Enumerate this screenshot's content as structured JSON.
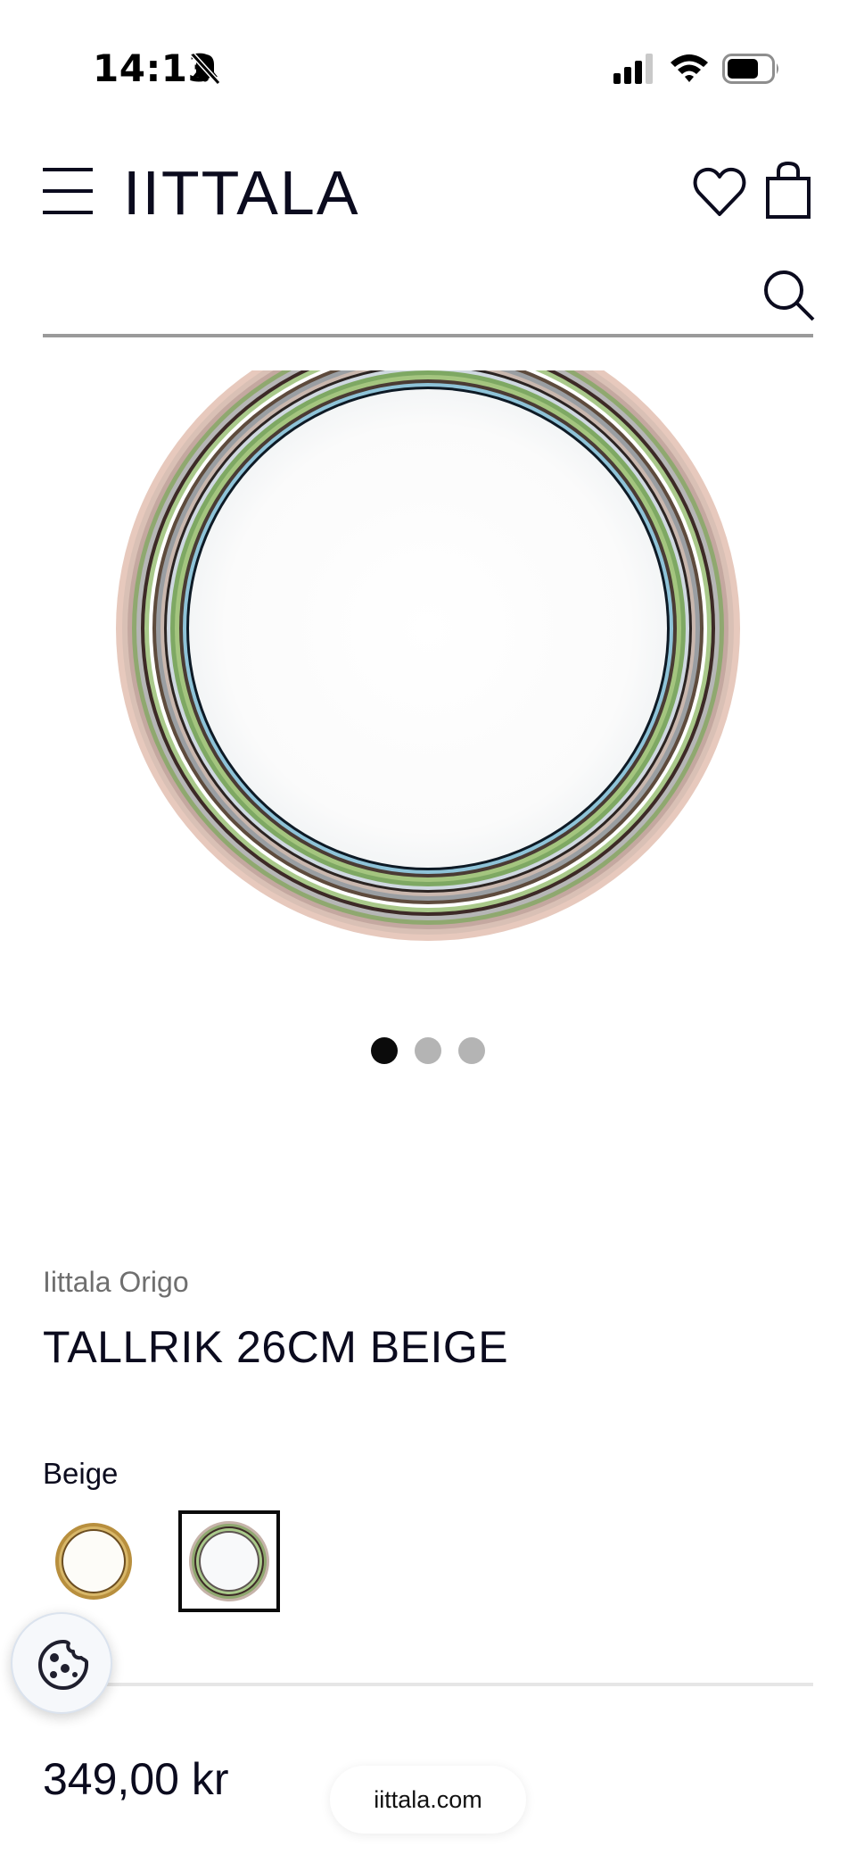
{
  "status_bar": {
    "time": "14:13",
    "icons": [
      "bell-slash-icon",
      "cellular-signal-icon",
      "wifi-icon",
      "battery-icon"
    ]
  },
  "header": {
    "logo": "IITTALA",
    "icons": [
      "hamburger-menu-icon",
      "heart-icon",
      "shopping-bag-icon"
    ]
  },
  "search": {
    "placeholder": "",
    "value": "",
    "icon": "search-icon"
  },
  "gallery": {
    "image_alt": "Origo plate beige",
    "slide_count": 3,
    "active_slide": 1
  },
  "product": {
    "brand": "Iittala Origo",
    "title": "TALLRIK 26CM BEIGE",
    "color_label": "Beige",
    "swatches": [
      {
        "name": "Origo gold ring variant",
        "selected": false
      },
      {
        "name": "Beige",
        "selected": true
      }
    ],
    "price": "349,00 kr"
  },
  "cookie_button": {
    "icon": "cookie-icon"
  },
  "browser": {
    "url": "iittala.com"
  },
  "colors": {
    "text_primary": "#0b0b1e",
    "text_secondary": "#6f6f6f",
    "dot_active": "#0b0b0b",
    "dot_inactive": "#b4b4b4",
    "divider": "#e6e6e6"
  }
}
